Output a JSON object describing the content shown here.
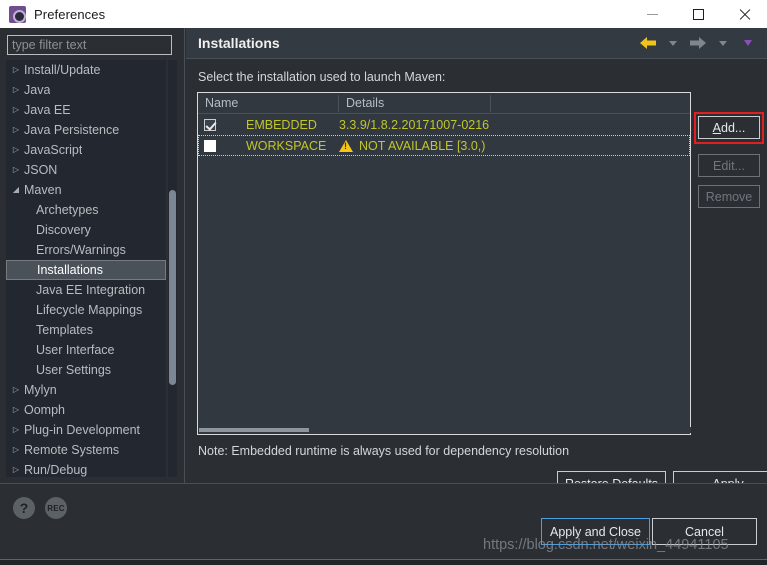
{
  "window": {
    "title": "Preferences",
    "icon": "preferences-gear-icon",
    "minimize_label": "",
    "maximize_label": "",
    "close_label": ""
  },
  "sidebar": {
    "filter": {
      "placeholder": "type filter text",
      "value": ""
    },
    "items": [
      {
        "label": "Install/Update",
        "level": 1,
        "expanded": false,
        "selected": false
      },
      {
        "label": "Java",
        "level": 1,
        "expanded": false,
        "selected": false
      },
      {
        "label": "Java EE",
        "level": 1,
        "expanded": false,
        "selected": false
      },
      {
        "label": "Java Persistence",
        "level": 1,
        "expanded": false,
        "selected": false
      },
      {
        "label": "JavaScript",
        "level": 1,
        "expanded": false,
        "selected": false
      },
      {
        "label": "JSON",
        "level": 1,
        "expanded": false,
        "selected": false
      },
      {
        "label": "Maven",
        "level": 1,
        "expanded": true,
        "selected": false
      },
      {
        "label": "Archetypes",
        "level": 2,
        "expanded": false,
        "selected": false
      },
      {
        "label": "Discovery",
        "level": 2,
        "expanded": false,
        "selected": false
      },
      {
        "label": "Errors/Warnings",
        "level": 2,
        "expanded": false,
        "selected": false
      },
      {
        "label": "Installations",
        "level": 2,
        "expanded": false,
        "selected": true
      },
      {
        "label": "Java EE Integration",
        "level": 2,
        "expanded": false,
        "selected": false
      },
      {
        "label": "Lifecycle Mappings",
        "level": 2,
        "expanded": false,
        "selected": false
      },
      {
        "label": "Templates",
        "level": 2,
        "expanded": false,
        "selected": false
      },
      {
        "label": "User Interface",
        "level": 2,
        "expanded": false,
        "selected": false
      },
      {
        "label": "User Settings",
        "level": 2,
        "expanded": false,
        "selected": false
      },
      {
        "label": "Mylyn",
        "level": 1,
        "expanded": false,
        "selected": false
      },
      {
        "label": "Oomph",
        "level": 1,
        "expanded": false,
        "selected": false
      },
      {
        "label": "Plug-in Development",
        "level": 1,
        "expanded": false,
        "selected": false
      },
      {
        "label": "Remote Systems",
        "level": 1,
        "expanded": false,
        "selected": false
      },
      {
        "label": "Run/Debug",
        "level": 1,
        "expanded": false,
        "selected": false
      }
    ]
  },
  "page": {
    "title": "Installations",
    "instruction": "Select the installation used to launch Maven:",
    "note": "Note: Embedded runtime is always used for dependency resolution",
    "nav": {
      "back_icon": "back-arrow-icon",
      "back_dropdown_icon": "chevron-down-icon",
      "forward_icon": "forward-arrow-icon",
      "forward_dropdown_icon": "chevron-down-icon",
      "menu_icon": "chevron-down-icon"
    }
  },
  "table": {
    "columns": [
      "Name",
      "Details"
    ],
    "rows": [
      {
        "checked": true,
        "name": "EMBEDDED",
        "details": "3.3.9/1.8.2.20171007-0216",
        "warning": false,
        "focused": false
      },
      {
        "checked": false,
        "name": "WORKSPACE",
        "details": "NOT AVAILABLE [3.0,)",
        "warning": true,
        "focused": true
      }
    ]
  },
  "buttons": {
    "add": {
      "label": "Add...",
      "enabled": true,
      "highlighted": true
    },
    "edit": {
      "label": "Edit...",
      "enabled": false
    },
    "remove": {
      "label": "Remove",
      "enabled": false
    },
    "restore_defaults": {
      "label": "Restore Defaults",
      "enabled": true
    },
    "apply": {
      "label": "Apply",
      "enabled": true
    },
    "apply_and_close": {
      "label": "Apply and Close",
      "enabled": true,
      "focused": true
    },
    "cancel": {
      "label": "Cancel",
      "enabled": true
    }
  },
  "bottom": {
    "help_icon": "question-mark-icon",
    "rec_icon": "rec-icon",
    "rec_label": "REC"
  },
  "watermark": {
    "text": "https://blog.csdn.net/weixin_44941105"
  },
  "colors": {
    "accent_yellow": "#c2c727",
    "warning": "#f5c518",
    "highlight_red": "#e02020",
    "focus_blue": "#4a9fe0",
    "back_arrow": "#f0c419",
    "background": "#2b2f34",
    "table_bg": "#313840"
  }
}
